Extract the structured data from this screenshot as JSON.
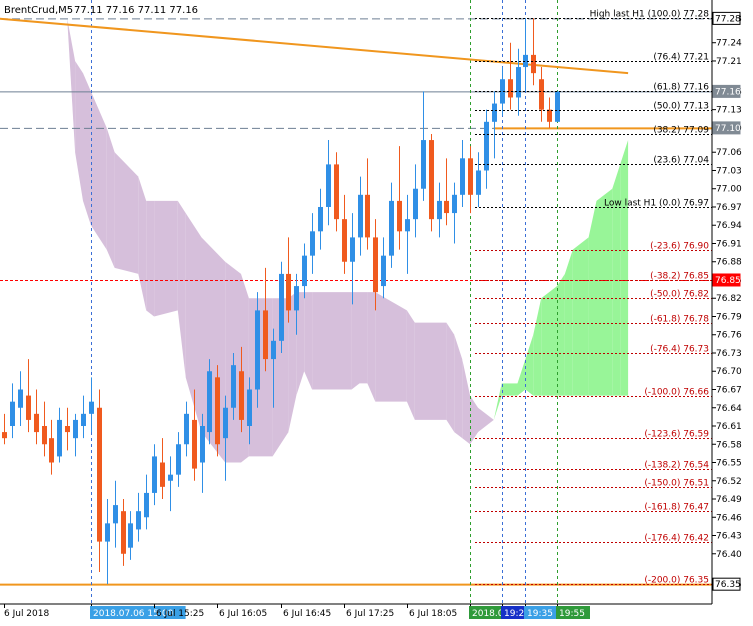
{
  "header": {
    "symbol_label": "BrentCrud,M5",
    "ohlc_text": "77.11 77.16 77.11 77.16"
  },
  "colors": {
    "bull": "#2f8fe6",
    "bear": "#f05a1e",
    "cloud_bear": "#d6bfdb",
    "cloud_bull": "#98f598",
    "trend": "#f0961e",
    "fib_up": "#000000",
    "fib_down": "#c00000",
    "grid_blue": "#3b6fd6",
    "grid_green": "#2e9e2e",
    "hline": "#6d7f93",
    "bid_line": "#ff0000",
    "ask_fill": "#808a94"
  },
  "chart_data": {
    "type": "candlestick",
    "symbol": "BrentCrud",
    "timeframe": "M5",
    "ylim": [
      76.324,
      77.302
    ],
    "price_axis_labels": [
      "77.28",
      "77.24",
      "77.21",
      "77.16",
      "77.13",
      "77.10",
      "77.06",
      "77.03",
      "77.00",
      "76.97",
      "76.94",
      "76.91",
      "76.88",
      "76.85",
      "76.82",
      "76.79",
      "76.76",
      "76.73",
      "76.70",
      "76.67",
      "76.64",
      "76.61",
      "76.58",
      "76.55",
      "76.52",
      "76.49",
      "76.46",
      "76.43",
      "76.40",
      "76.35"
    ],
    "current_labels": [
      {
        "text": "77.28",
        "style": "box",
        "price": 77.28
      },
      {
        "text": "77.16",
        "style": "box-gray",
        "price": 77.16
      },
      {
        "text": "77.10",
        "style": "box-gray",
        "price": 77.1
      },
      {
        "text": "76.85",
        "style": "box-red",
        "price": 76.85
      },
      {
        "text": "76.35",
        "style": "box",
        "price": 76.35
      }
    ],
    "time_labels": [
      {
        "text": "6 Jul 2018",
        "bar": 0,
        "style": "plain"
      },
      {
        "text": "2018.07.06 15:00",
        "bar": 11,
        "style": "blue"
      },
      {
        "text": "6 Jul 15:25",
        "bar": 19,
        "style": "plain"
      },
      {
        "text": "6 Jul 16:05",
        "bar": 27,
        "style": "plain"
      },
      {
        "text": "6 Jul 16:45",
        "bar": 35,
        "style": "plain"
      },
      {
        "text": "6 Jul 17:25",
        "bar": 43,
        "style": "plain"
      },
      {
        "text": "6 Jul 18:05",
        "bar": 51,
        "style": "plain"
      },
      {
        "text": "2018.07.06 19:00",
        "bar": 59,
        "style": "green"
      },
      {
        "text": "19:20",
        "bar": 63,
        "style": "navy"
      },
      {
        "text": "19:35",
        "bar": 66,
        "style": "blue"
      },
      {
        "text": "19:55",
        "bar": 70,
        "style": "green"
      }
    ],
    "fib_levels": [
      {
        "label": "High last H1 (100.0) 77.28",
        "price": 77.28,
        "dir": "up"
      },
      {
        "label": "(76.4) 77.21",
        "price": 77.21,
        "dir": "up"
      },
      {
        "label": "(61.8) 77.16",
        "price": 77.16,
        "dir": "up"
      },
      {
        "label": "(50.0) 77.13",
        "price": 77.13,
        "dir": "up"
      },
      {
        "label": "(38.2) 77.09",
        "price": 77.09,
        "dir": "up"
      },
      {
        "label": "(23.6) 77.04",
        "price": 77.04,
        "dir": "up"
      },
      {
        "label": "Low last H1 (0.0) 76.97",
        "price": 76.97,
        "dir": "up"
      },
      {
        "label": "(-23.6) 76.90",
        "price": 76.9,
        "dir": "down"
      },
      {
        "label": "(-38.2) 76.85",
        "price": 76.85,
        "dir": "down"
      },
      {
        "label": "(-50.0) 76.82",
        "price": 76.82,
        "dir": "down"
      },
      {
        "label": "(-61.8) 76.78",
        "price": 76.78,
        "dir": "down"
      },
      {
        "label": "(-76.4) 76.73",
        "price": 76.73,
        "dir": "down"
      },
      {
        "label": "(-100.0) 76.66",
        "price": 76.66,
        "dir": "down"
      },
      {
        "label": "(-123.6) 76.59",
        "price": 76.59,
        "dir": "down"
      },
      {
        "label": "(-138.2) 76.54",
        "price": 76.54,
        "dir": "down"
      },
      {
        "label": "(-150.0) 76.51",
        "price": 76.51,
        "dir": "down"
      },
      {
        "label": "(-161.8) 76.47",
        "price": 76.47,
        "dir": "down"
      },
      {
        "label": "(-176.4) 76.42",
        "price": 76.42,
        "dir": "down"
      },
      {
        "label": "(-200.0) 76.35",
        "price": 76.35,
        "dir": "down"
      }
    ],
    "horizontal_lines": [
      {
        "price": 77.28,
        "style": "dash",
        "color": "hline"
      },
      {
        "price": 77.1,
        "style": "dash",
        "color": "hline"
      },
      {
        "price": 77.16,
        "style": "solid",
        "color": "hline"
      },
      {
        "price": 76.85,
        "style": "dash",
        "color": "bid_line"
      },
      {
        "price": 76.35,
        "style": "solid",
        "color": "trend"
      },
      {
        "price": 77.1,
        "style": "solid",
        "color": "trend",
        "from_bar": 62
      }
    ],
    "trendline": {
      "from": {
        "bar": -1,
        "price": 77.28
      },
      "to": {
        "bar": 79,
        "price": 77.19
      }
    },
    "vertical_lines": [
      {
        "bar": 11,
        "color": "grid_blue"
      },
      {
        "bar": 59,
        "color": "grid_green"
      },
      {
        "bar": 63,
        "color": "grid_blue"
      },
      {
        "bar": 66,
        "color": "grid_blue"
      },
      {
        "bar": 70,
        "color": "grid_green"
      }
    ],
    "candles": [
      [
        76.6,
        76.63,
        76.58,
        76.59
      ],
      [
        76.61,
        76.68,
        76.59,
        76.65
      ],
      [
        76.64,
        76.7,
        76.61,
        76.67
      ],
      [
        76.66,
        76.72,
        76.6,
        76.62
      ],
      [
        76.63,
        76.67,
        76.58,
        76.6
      ],
      [
        76.61,
        76.65,
        76.56,
        76.58
      ],
      [
        76.59,
        76.62,
        76.53,
        76.55
      ],
      [
        76.56,
        76.64,
        76.55,
        76.62
      ],
      [
        76.61,
        76.64,
        76.57,
        76.6
      ],
      [
        76.59,
        76.63,
        76.56,
        76.62
      ],
      [
        76.61,
        76.66,
        76.59,
        76.63
      ],
      [
        76.63,
        76.69,
        76.6,
        76.65
      ],
      [
        76.64,
        76.67,
        76.37,
        76.42
      ],
      [
        76.42,
        76.49,
        76.35,
        76.45
      ],
      [
        76.45,
        76.52,
        76.41,
        76.48
      ],
      [
        76.47,
        76.49,
        76.38,
        76.4
      ],
      [
        76.41,
        76.47,
        76.39,
        76.45
      ],
      [
        76.44,
        76.5,
        76.42,
        76.47
      ],
      [
        76.46,
        76.53,
        76.44,
        76.5
      ],
      [
        76.5,
        76.58,
        76.48,
        76.56
      ],
      [
        76.55,
        76.59,
        76.49,
        76.51
      ],
      [
        76.52,
        76.56,
        76.47,
        76.53
      ],
      [
        76.53,
        76.6,
        76.51,
        76.58
      ],
      [
        76.58,
        76.65,
        76.56,
        76.63
      ],
      [
        76.62,
        76.67,
        76.52,
        76.54
      ],
      [
        76.55,
        76.63,
        76.5,
        76.61
      ],
      [
        76.6,
        76.72,
        76.58,
        76.7
      ],
      [
        76.69,
        76.71,
        76.56,
        76.58
      ],
      [
        76.59,
        76.66,
        76.52,
        76.64
      ],
      [
        76.64,
        76.73,
        76.62,
        76.71
      ],
      [
        76.7,
        76.74,
        76.6,
        76.62
      ],
      [
        76.61,
        76.69,
        76.58,
        76.67
      ],
      [
        76.67,
        76.83,
        76.64,
        76.8
      ],
      [
        76.8,
        76.87,
        76.7,
        76.72
      ],
      [
        76.72,
        76.77,
        76.64,
        76.75
      ],
      [
        76.75,
        76.88,
        76.73,
        76.86
      ],
      [
        76.86,
        76.92,
        76.78,
        76.8
      ],
      [
        76.8,
        76.86,
        76.76,
        76.84
      ],
      [
        76.84,
        76.91,
        76.82,
        76.89
      ],
      [
        76.89,
        76.96,
        76.86,
        76.93
      ],
      [
        76.93,
        77.0,
        76.9,
        76.97
      ],
      [
        76.97,
        77.08,
        76.94,
        77.04
      ],
      [
        77.04,
        77.06,
        76.93,
        76.95
      ],
      [
        76.95,
        76.99,
        76.86,
        76.88
      ],
      [
        76.88,
        76.96,
        76.81,
        76.92
      ],
      [
        76.92,
        77.02,
        76.89,
        76.99
      ],
      [
        76.99,
        77.05,
        76.9,
        76.92
      ],
      [
        76.92,
        76.95,
        76.8,
        76.83
      ],
      [
        76.84,
        76.92,
        76.82,
        76.89
      ],
      [
        76.89,
        77.01,
        76.87,
        76.98
      ],
      [
        76.98,
        77.07,
        76.9,
        76.93
      ],
      [
        76.93,
        76.99,
        76.86,
        76.95
      ],
      [
        76.95,
        77.04,
        76.92,
        77.0
      ],
      [
        77.0,
        77.16,
        76.98,
        77.08
      ],
      [
        77.08,
        77.09,
        76.93,
        76.95
      ],
      [
        76.95,
        77.01,
        76.92,
        76.98
      ],
      [
        76.98,
        77.05,
        76.94,
        76.96
      ],
      [
        76.96,
        77.01,
        76.91,
        76.99
      ],
      [
        76.99,
        77.08,
        76.97,
        77.05
      ],
      [
        77.05,
        77.07,
        76.96,
        76.99
      ],
      [
        76.99,
        77.06,
        76.97,
        77.03
      ],
      [
        77.03,
        77.13,
        77.0,
        77.11
      ],
      [
        77.11,
        77.16,
        77.05,
        77.14
      ],
      [
        77.14,
        77.2,
        77.12,
        77.18
      ],
      [
        77.18,
        77.24,
        77.13,
        77.15
      ],
      [
        77.15,
        77.23,
        77.12,
        77.2
      ],
      [
        77.2,
        77.28,
        77.16,
        77.22
      ],
      [
        77.22,
        77.28,
        77.17,
        77.19
      ],
      [
        77.18,
        77.2,
        77.11,
        77.13
      ],
      [
        77.13,
        77.15,
        77.1,
        77.11
      ],
      [
        77.11,
        77.16,
        77.11,
        77.16
      ]
    ],
    "cloud": {
      "upper": [
        [
          -1,
          77.28
        ],
        [
          8,
          77.28
        ],
        [
          9,
          77.06
        ],
        [
          10,
          76.98
        ],
        [
          11,
          76.94
        ],
        [
          13,
          76.9
        ],
        [
          14,
          76.87
        ],
        [
          17,
          76.86
        ],
        [
          18,
          76.8
        ],
        [
          19,
          76.79
        ],
        [
          22,
          76.8
        ],
        [
          23,
          76.69
        ],
        [
          25,
          76.6
        ],
        [
          28,
          76.55
        ],
        [
          30,
          76.55
        ],
        [
          31,
          76.56
        ],
        [
          34,
          76.56
        ],
        [
          36,
          76.6
        ],
        [
          37,
          76.66
        ],
        [
          38,
          76.7
        ],
        [
          39,
          76.67
        ],
        [
          40,
          76.67
        ],
        [
          44,
          76.67
        ],
        [
          45,
          76.68
        ],
        [
          46,
          76.68
        ],
        [
          47,
          76.65
        ],
        [
          51,
          76.65
        ],
        [
          52,
          76.62
        ],
        [
          56,
          76.62
        ],
        [
          57,
          76.6
        ],
        [
          58,
          76.59
        ],
        [
          59,
          76.58
        ],
        [
          60,
          76.6
        ],
        [
          62,
          76.62
        ],
        [
          63,
          76.68
        ],
        [
          65,
          76.68
        ],
        [
          66,
          76.72
        ],
        [
          67,
          76.76
        ],
        [
          68,
          76.82
        ],
        [
          70,
          76.84
        ],
        [
          71,
          76.86
        ],
        [
          72,
          76.9
        ],
        [
          74,
          76.92
        ],
        [
          75,
          76.98
        ],
        [
          77,
          77.0
        ],
        [
          78,
          77.04
        ],
        [
          79,
          77.08
        ]
      ],
      "lower": [
        [
          -1,
          77.28
        ],
        [
          8,
          77.28
        ],
        [
          9,
          77.21
        ],
        [
          10,
          77.19
        ],
        [
          11,
          77.16
        ],
        [
          13,
          77.1
        ],
        [
          14,
          77.06
        ],
        [
          17,
          77.02
        ],
        [
          18,
          76.98
        ],
        [
          19,
          76.98
        ],
        [
          22,
          76.98
        ],
        [
          23,
          76.96
        ],
        [
          25,
          76.92
        ],
        [
          28,
          76.88
        ],
        [
          30,
          76.86
        ],
        [
          31,
          76.82
        ],
        [
          34,
          76.82
        ],
        [
          36,
          76.82
        ],
        [
          37,
          76.83
        ],
        [
          38,
          76.83
        ],
        [
          39,
          76.83
        ],
        [
          40,
          76.83
        ],
        [
          44,
          76.83
        ],
        [
          45,
          76.83
        ],
        [
          46,
          76.83
        ],
        [
          47,
          76.83
        ],
        [
          51,
          76.8
        ],
        [
          52,
          76.78
        ],
        [
          56,
          76.78
        ],
        [
          57,
          76.76
        ],
        [
          58,
          76.72
        ],
        [
          59,
          76.66
        ],
        [
          60,
          76.64
        ],
        [
          62,
          76.62
        ],
        [
          63,
          76.66
        ],
        [
          65,
          76.66
        ],
        [
          66,
          76.67
        ],
        [
          67,
          76.66
        ],
        [
          68,
          76.66
        ],
        [
          70,
          76.66
        ],
        [
          71,
          76.66
        ],
        [
          72,
          76.66
        ],
        [
          74,
          76.66
        ],
        [
          75,
          76.66
        ],
        [
          77,
          76.66
        ],
        [
          78,
          76.66
        ],
        [
          79,
          76.66
        ]
      ]
    }
  }
}
